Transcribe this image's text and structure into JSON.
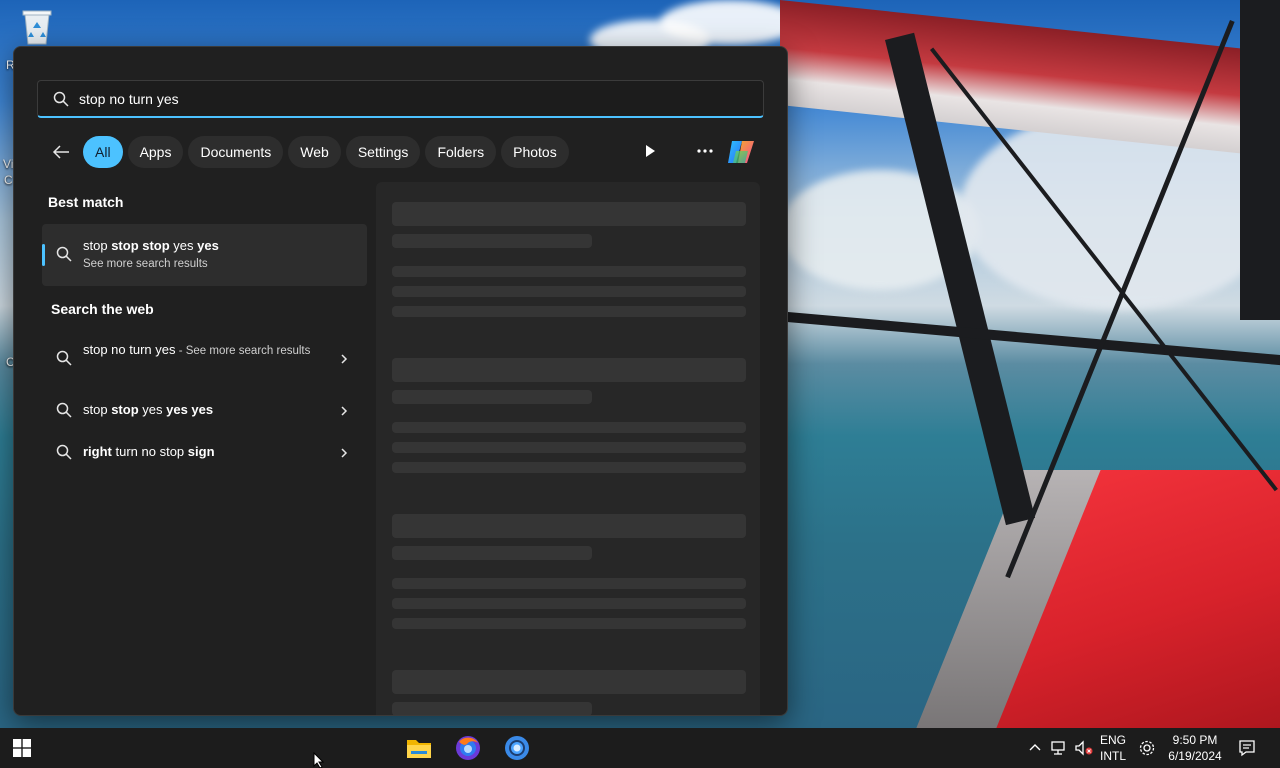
{
  "search": {
    "query": "stop no turn yes"
  },
  "filters": {
    "chips": [
      {
        "label": "All",
        "active": true
      },
      {
        "label": "Apps",
        "active": false
      },
      {
        "label": "Documents",
        "active": false
      },
      {
        "label": "Web",
        "active": false
      },
      {
        "label": "Settings",
        "active": false
      },
      {
        "label": "Folders",
        "active": false
      },
      {
        "label": "Photos",
        "active": false
      }
    ]
  },
  "best_match": {
    "heading": "Best match",
    "title_parts": [
      "stop ",
      "stop stop",
      " yes ",
      "yes"
    ],
    "subtitle": "See more search results"
  },
  "web": {
    "heading": "Search the web",
    "items": [
      {
        "parts": [
          "stop no turn yes"
        ],
        "suffix": " - See more search results"
      },
      {
        "parts": [
          "stop ",
          "stop",
          " yes ",
          "yes yes"
        ]
      },
      {
        "parts": [
          "right",
          " turn no stop ",
          "sign"
        ]
      }
    ]
  },
  "desktop": {
    "label_r": "R",
    "label_v": "Vi",
    "label_c": "C",
    "label_c2": "C"
  },
  "taskbar": {
    "lang_top": "ENG",
    "lang_bottom": "INTL",
    "time": "9:50 PM",
    "date": "6/19/2024"
  },
  "colors": {
    "accent": "#4cc2ff",
    "panel_bg": "#202020"
  }
}
